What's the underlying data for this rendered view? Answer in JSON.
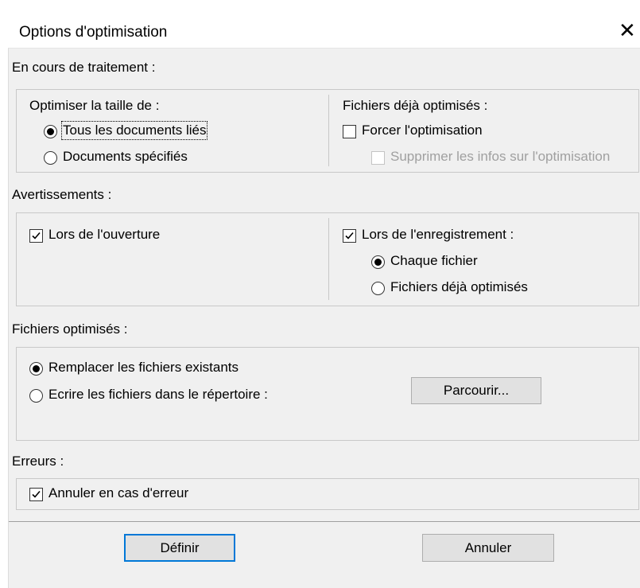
{
  "dialog": {
    "title": "Options d'optimisation",
    "close_glyph": "✕"
  },
  "processing": {
    "label": "En cours de traitement :",
    "optimize_size": {
      "label": "Optimiser la taille de :",
      "options": [
        {
          "label": "Tous les documents liés",
          "checked": true,
          "mnemonic": "T"
        },
        {
          "label": "Documents spécifiés",
          "checked": false,
          "mnemonic": "D"
        }
      ]
    },
    "already_optimized": {
      "label": "Fichiers déjà optimisés :",
      "force": {
        "label": "Forcer l'optimisation",
        "checked": false
      },
      "remove_info": {
        "label": "Supprimer les infos sur l'optimisation",
        "checked": false,
        "enabled": false
      }
    }
  },
  "warnings": {
    "label": "Avertissements :",
    "on_open": {
      "label": "Lors de l'ouverture",
      "checked": true
    },
    "on_save": {
      "label": "Lors de l'enregistrement :",
      "checked": true,
      "options": [
        {
          "label": "Chaque fichier",
          "checked": true
        },
        {
          "label": "Fichiers déjà optimisés",
          "checked": false
        }
      ]
    }
  },
  "optimized_files": {
    "label": "Fichiers optimisés :",
    "options": [
      {
        "label": "Remplacer les fichiers existants",
        "checked": true
      },
      {
        "label": "Ecrire les fichiers dans le répertoire :",
        "checked": false
      }
    ],
    "browse_label": "Parcourir..."
  },
  "errors": {
    "label": "Erreurs :",
    "cancel_on_error": {
      "label": "Annuler en cas d'erreur",
      "checked": true
    }
  },
  "buttons": {
    "define": "Définir",
    "cancel": "Annuler"
  },
  "colors": {
    "dialog_bg": "#f0f0f0",
    "button_bg": "#e1e1e1",
    "default_button_border": "#0078d7",
    "disabled_text": "#a0a0a0"
  }
}
